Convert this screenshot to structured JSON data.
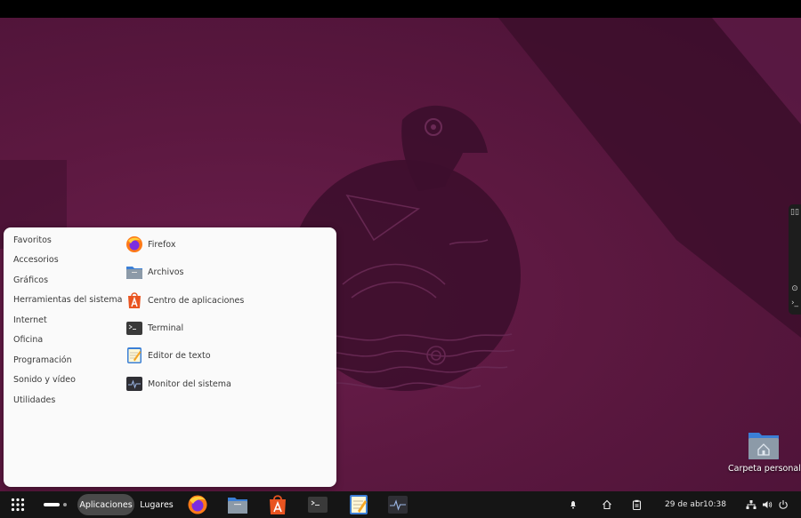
{
  "menu": {
    "categories": [
      {
        "label": "Favoritos"
      },
      {
        "label": "Accesorios"
      },
      {
        "label": "Gráficos"
      },
      {
        "label": "Herramientas del sistema"
      },
      {
        "label": "Internet"
      },
      {
        "label": "Oficina"
      },
      {
        "label": "Programación"
      },
      {
        "label": "Sonido y vídeo"
      },
      {
        "label": "Utilidades"
      }
    ],
    "apps": [
      {
        "label": "Firefox",
        "icon": "firefox-icon"
      },
      {
        "label": "Archivos",
        "icon": "files-icon"
      },
      {
        "label": "Centro de aplicaciones",
        "icon": "app-center-icon"
      },
      {
        "label": "Terminal",
        "icon": "terminal-icon"
      },
      {
        "label": "Editor de texto",
        "icon": "text-editor-icon"
      },
      {
        "label": "Monitor del sistema",
        "icon": "system-monitor-icon"
      }
    ]
  },
  "desktop": {
    "home_label": "Carpeta personal"
  },
  "panel": {
    "aplicaciones_label": "Aplicaciones",
    "lugares_label": "Lugares",
    "date": "29 de abr",
    "time": "10:38"
  },
  "colors": {
    "wallpaper": "#5c1840",
    "panel": "#151515",
    "menu_bg": "#fafafa",
    "firefox_orange": "#ff7a18",
    "app_center_orange": "#e95420",
    "folder_blue": "#3b7fd6"
  }
}
